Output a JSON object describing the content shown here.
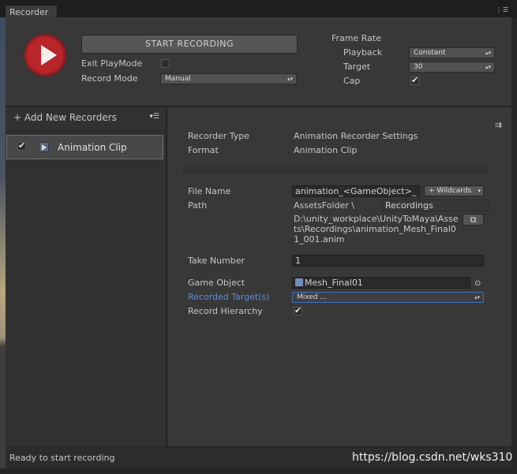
{
  "window": {
    "tab_title": "Recorder",
    "menu_icon": "menu-icon"
  },
  "top": {
    "start_recording": "START RECORDING",
    "exit_playmode_label": "Exit PlayMode",
    "exit_playmode_checked": false,
    "record_mode_label": "Record Mode",
    "record_mode_value": "Manual",
    "frame_rate_label": "Frame Rate",
    "playback_label": "Playback",
    "playback_value": "Constant",
    "target_label": "Target",
    "target_value": "30",
    "cap_label": "Cap",
    "cap_checked": true
  },
  "left": {
    "add_label": "+ Add New Recorders",
    "items": [
      {
        "label": "Animation Clip",
        "enabled": true,
        "icon": "animation-clip-icon"
      }
    ]
  },
  "settings": {
    "recorder_type_label": "Recorder Type",
    "recorder_type_value": "Animation Recorder Settings",
    "format_label": "Format",
    "format_value": "Animation Clip",
    "file_name_label": "File Name",
    "file_name_value": "animation_<GameObject>_",
    "wildcards_label": "+ Wildcards",
    "path_label": "Path",
    "path_root": "AssetsFolder \\",
    "path_folder": "Recordings",
    "full_path": "D:\\unity_workplace\\UnityToMaya\\Assets\\Recordings\\animation_Mesh_Final01_001.anim",
    "take_number_label": "Take Number",
    "take_number_value": "1",
    "game_object_label": "Game Object",
    "game_object_value": "Mesh_Final01",
    "recorded_targets_label": "Recorded Target(s)",
    "recorded_targets_value": "Mixed ...",
    "record_hierarchy_label": "Record Hierarchy",
    "record_hierarchy_checked": true
  },
  "status": {
    "text": "Ready to start recording"
  },
  "watermark": "https://blog.csdn.net/wks310",
  "colors": {
    "record_red": "#b8252a",
    "link_blue": "#5b8be0"
  }
}
